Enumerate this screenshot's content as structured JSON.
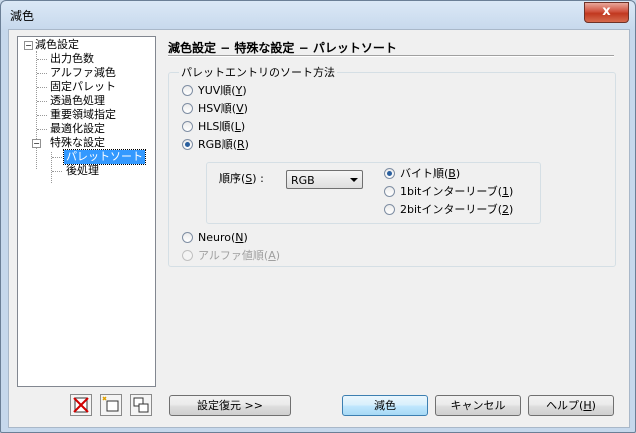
{
  "window": {
    "title": "減色",
    "close": "x"
  },
  "tree": {
    "root": {
      "label": "減色設定",
      "expander": "−"
    },
    "items": [
      "出力色数",
      "アルファ減色",
      "固定パレット",
      "透過色処理",
      "重要領域指定",
      "最適化設定"
    ],
    "special": {
      "label": "特殊な設定",
      "expander": "−"
    },
    "special_children": [
      "パレットソート",
      "後処理"
    ]
  },
  "panel": {
    "header": "減色設定 − 特殊な設定 − パレットソート"
  },
  "sort_group": {
    "label": "パレットエントリのソート方法",
    "options": [
      {
        "text": "YUV順(",
        "key": "Y",
        "checked": false,
        "disabled": false
      },
      {
        "text": "HSV順(",
        "key": "V",
        "checked": false,
        "disabled": false
      },
      {
        "text": "HLS順(",
        "key": "L",
        "checked": false,
        "disabled": false
      },
      {
        "text": "RGB順(",
        "key": "R",
        "checked": true,
        "disabled": false
      }
    ],
    "order": {
      "label_pre": "順序(",
      "label_key": "S",
      "label_post": ") :",
      "value": "RGB",
      "options": [
        {
          "text": "バイト順(",
          "key": "B",
          "checked": true
        },
        {
          "text": "1bitインターリーブ(",
          "key": "1",
          "checked": false
        },
        {
          "text": "2bitインターリーブ(",
          "key": "2",
          "checked": false
        }
      ]
    },
    "extra_options": [
      {
        "text": "Neuro(",
        "key": "N",
        "checked": false,
        "disabled": false
      },
      {
        "text": "アルファ値順(",
        "key": "A",
        "checked": false,
        "disabled": true
      }
    ]
  },
  "buttons": {
    "restore": "設定復元 >>",
    "ok": "減色",
    "cancel": "キャンセル",
    "help_pre": "ヘルプ(",
    "help_key": "H",
    "help_post": ")"
  },
  "toolbar": {
    "icons": [
      "delete-icon",
      "new-folder-icon",
      "copy-tree-icon"
    ]
  }
}
